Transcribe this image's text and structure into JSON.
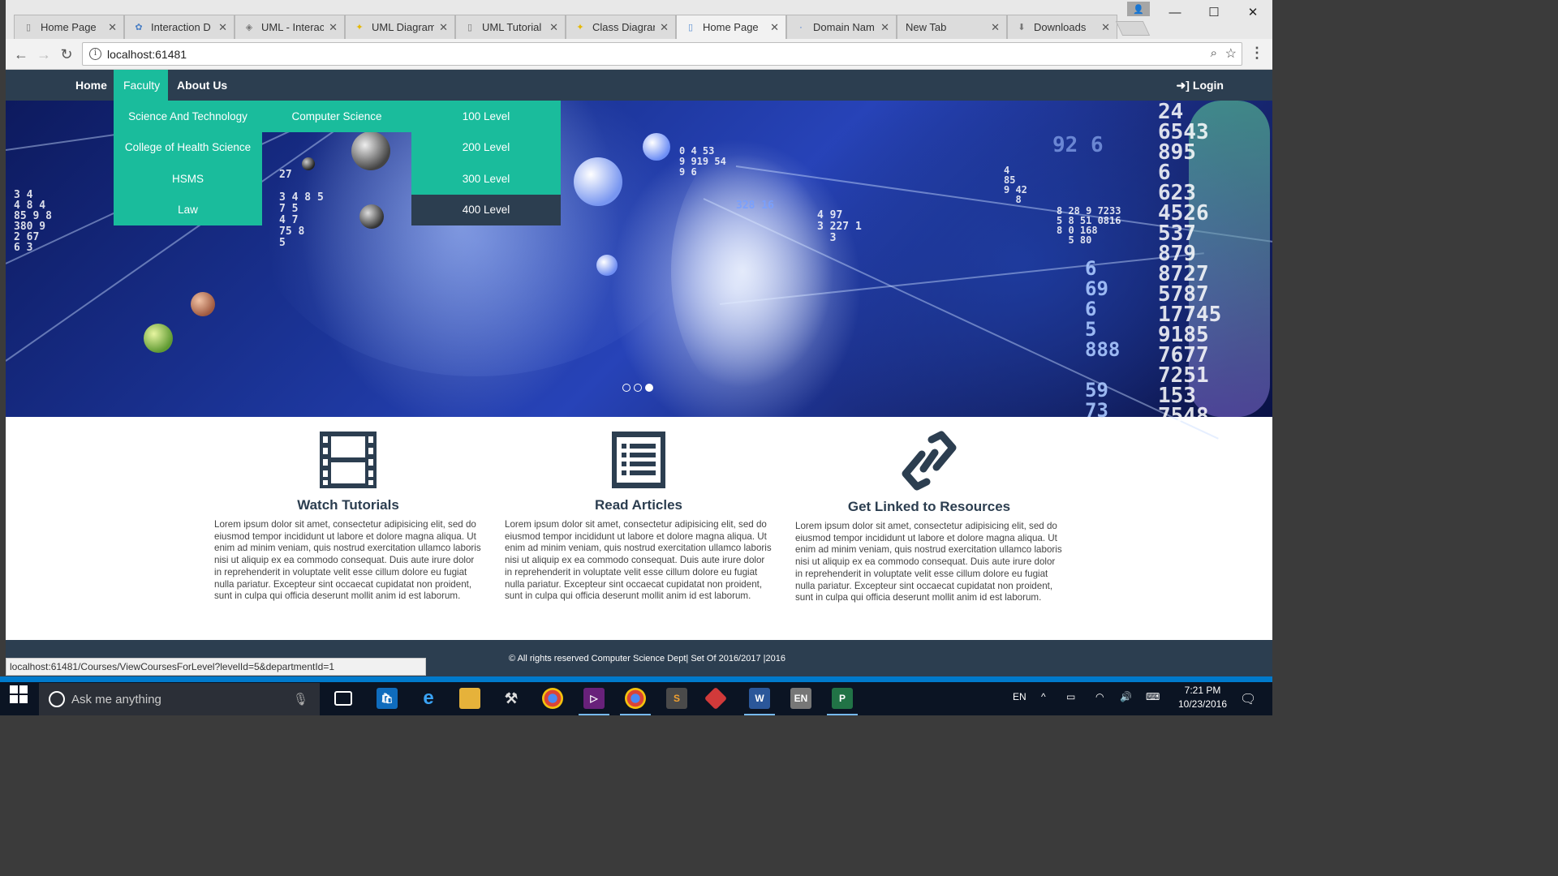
{
  "browser": {
    "tabs": [
      {
        "title": "Home Page",
        "active": false
      },
      {
        "title": "Interaction D",
        "active": false
      },
      {
        "title": "UML - Interac",
        "active": false
      },
      {
        "title": "UML Diagram",
        "active": false
      },
      {
        "title": "UML Tutorial",
        "active": false
      },
      {
        "title": "Class Diagran",
        "active": false
      },
      {
        "title": "Home Page",
        "active": true
      },
      {
        "title": "Domain Nam",
        "active": false
      },
      {
        "title": "New Tab",
        "active": false
      },
      {
        "title": "Downloads",
        "active": false
      }
    ],
    "url": "localhost:61481",
    "status_url": "localhost:61481/Courses/ViewCoursesForLevel?levelId=5&departmentId=1"
  },
  "navbar": {
    "home": "Home",
    "faculty": "Faculty",
    "about": "About Us",
    "login": "Login"
  },
  "dropdown": {
    "faculties": [
      "Science And Technology",
      "College of Health Science",
      "HSMS",
      "Law"
    ],
    "departments": [
      "Computer Science"
    ],
    "levels": [
      "100 Level",
      "200 Level",
      "300 Level",
      "400 Level"
    ],
    "hovered_level": "400 Level"
  },
  "carousel": {
    "slides": 3,
    "active": 3
  },
  "features": [
    {
      "title": "Watch Tutorials",
      "icon": "film-icon",
      "text": "Lorem ipsum dolor sit amet, consectetur adipisicing elit, sed do eiusmod tempor incididunt ut labore et dolore magna aliqua. Ut enim ad minim veniam, quis nostrud exercitation ullamco laboris nisi ut aliquip ex ea commodo consequat. Duis aute irure dolor in reprehenderit in voluptate velit esse cillum dolore eu fugiat nulla pariatur. Excepteur sint occaecat cupidatat non proident, sunt in culpa qui officia deserunt mollit anim id est laborum."
    },
    {
      "title": "Read Articles",
      "icon": "list-document-icon",
      "text": "Lorem ipsum dolor sit amet, consectetur adipisicing elit, sed do eiusmod tempor incididunt ut labore et dolore magna aliqua. Ut enim ad minim veniam, quis nostrud exercitation ullamco laboris nisi ut aliquip ex ea commodo consequat. Duis aute irure dolor in reprehenderit in voluptate velit esse cillum dolore eu fugiat nulla pariatur. Excepteur sint occaecat cupidatat non proident, sunt in culpa qui officia deserunt mollit anim id est laborum."
    },
    {
      "title": "Get Linked to Resources",
      "icon": "link-icon",
      "text": "Lorem ipsum dolor sit amet, consectetur adipisicing elit, sed do eiusmod tempor incididunt ut labore et dolore magna aliqua. Ut enim ad minim veniam, quis nostrud exercitation ullamco laboris nisi ut aliquip ex ea commodo consequat. Duis aute irure dolor in reprehenderit in voluptate velit esse cillum dolore eu fugiat nulla pariatur. Excepteur sint occaecat cupidatat non proident, sunt in culpa qui officia deserunt mollit anim id est laborum."
    }
  ],
  "footer": {
    "text": "© All rights reserved Computer Science Dept| Set Of 2016/2017 |2016"
  },
  "taskbar": {
    "search_placeholder": "Ask me anything",
    "language": "EN",
    "time": "7:21 PM",
    "date": "10/23/2016"
  },
  "colors": {
    "navbar": "#2c3e50",
    "accent": "#1abc9c"
  }
}
